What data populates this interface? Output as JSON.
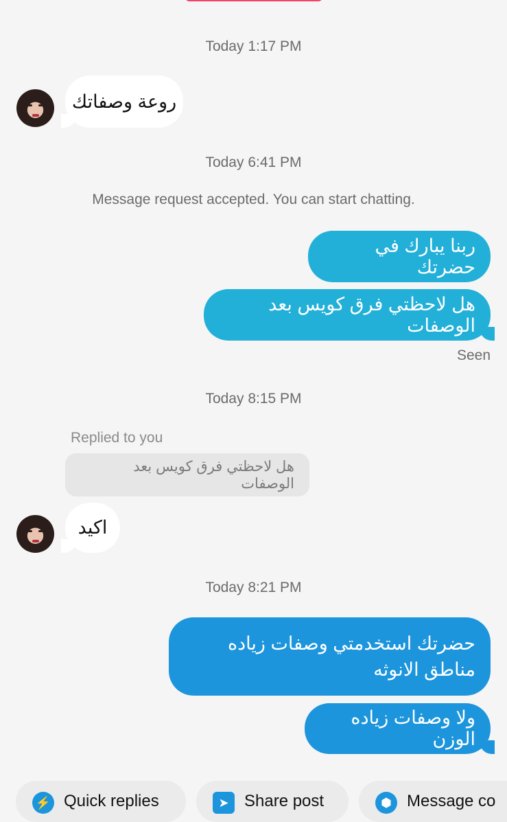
{
  "timestamps": {
    "t1": "Today 1:17 PM",
    "t2": "Today 6:41 PM",
    "t3": "Today 8:15 PM",
    "t4": "Today 8:21 PM"
  },
  "system_message": "Message request accepted. You can start chatting.",
  "messages": {
    "in_1": "روعة وصفاتك",
    "out_1": "ربنا يبارك في حضرتك",
    "out_2": "هل لاحظتي فرق كويس بعد الوصفات",
    "in_2": "اكيد",
    "out_3": "حضرتك استخدمتي وصفات زياده مناطق الانوثه",
    "out_4": "ولا وصفات زياده الوزن"
  },
  "seen_label": "Seen",
  "reply": {
    "label": "Replied to you",
    "quoted": "هل لاحظتي فرق كويس بعد الوصفات"
  },
  "chips": {
    "quick_replies": "Quick replies",
    "share_post": "Share post",
    "message_more": "Message co"
  },
  "icons": {
    "quick_replies": "lightning-icon",
    "share_post": "share-icon",
    "message_more": "hexagon-icon"
  },
  "colors": {
    "outgoing_cyan": "#22b0d8",
    "outgoing_blue": "#1c95dc",
    "incoming": "#ffffff",
    "accent_pill": "#f2426b"
  }
}
